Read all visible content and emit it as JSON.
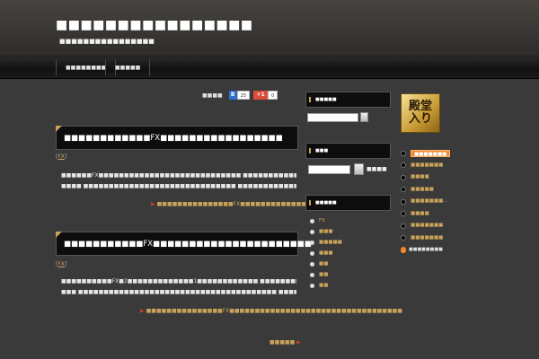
{
  "header": {
    "title": "■■■■■■■■■■■■■■■■",
    "description": "■■■■■■■■■■■■■■■■"
  },
  "nav": {
    "items": [
      "■■■■■■■■",
      "■■■■■"
    ]
  },
  "share": {
    "label": "■■■■",
    "hatena_count": "25",
    "gplus_label": "+1",
    "gplus_count": "0"
  },
  "posts": [
    {
      "title": "■■■■■■■■■■■■FX■■■■■■■■■■■■■■■■■",
      "category": "FX",
      "body_lines": [
        "■■■■■■FX■■■■■■■■■■■■■■■■■■■■■■■■■■■■ ■■■■■■■■■■■■■■■■■■■■FX■■■■■■■■",
        "■■■■ ■■■■■■■■■■■■■■■■■■■■■■■■■■■■■■ ■■■■■■■■■■■■■■■■■"
      ],
      "read_more": "■■■■■■■■■■■■■■■FX■■■■■■■■■■■■■■■■■■■■■■■■■■■■■"
    },
    {
      "title": "■■■■■■■■■■■FX■■■■■■■■■■■■■■■■■■■■■■",
      "category": "FX",
      "body_lines": [
        "■■■■■■■■■■FX■2■■■■■■■■■■■■■1■■■■■■■■■■■■ ■■■■■■■■■■■■■■■■■■■■■■■■■■■■■",
        "■■■ ■■■■■■■■■■■■■■■■■■■■■■■■■■■■■■■■■■■■■■■ ■■■■■■"
      ],
      "read_more": "■■■■■■■■■■■■■■■FX■■■■■■■■■■■■■■■■■■■■■■■■■■■■■■■■■■"
    }
  ],
  "pagination": {
    "next_label": "■■■■■"
  },
  "sidebar": {
    "search_title": "■■■■■",
    "search2_title": "■■■",
    "search2_button_label": "■■■■",
    "categories_title": "■■■■■",
    "categories": [
      "FX",
      "■■■",
      "■■■■■",
      "■■■",
      "■■",
      "■■",
      "■■"
    ]
  },
  "ranking": {
    "badge_line1": "殿堂",
    "badge_line2": "入り",
    "items": [
      "■■■■■■■",
      "■■■■■■■",
      "■■■■",
      "■■■■■",
      "■■■■■■■...",
      "■■■■",
      "■■■■■■■",
      "■■■■■■■"
    ],
    "footer": "■■■■■■■■"
  },
  "colors": {
    "accent": "#c8a25a",
    "background": "#3a3a3a",
    "header_dark": "#0d0d0d",
    "rank_highlight": "#f28a2c"
  }
}
